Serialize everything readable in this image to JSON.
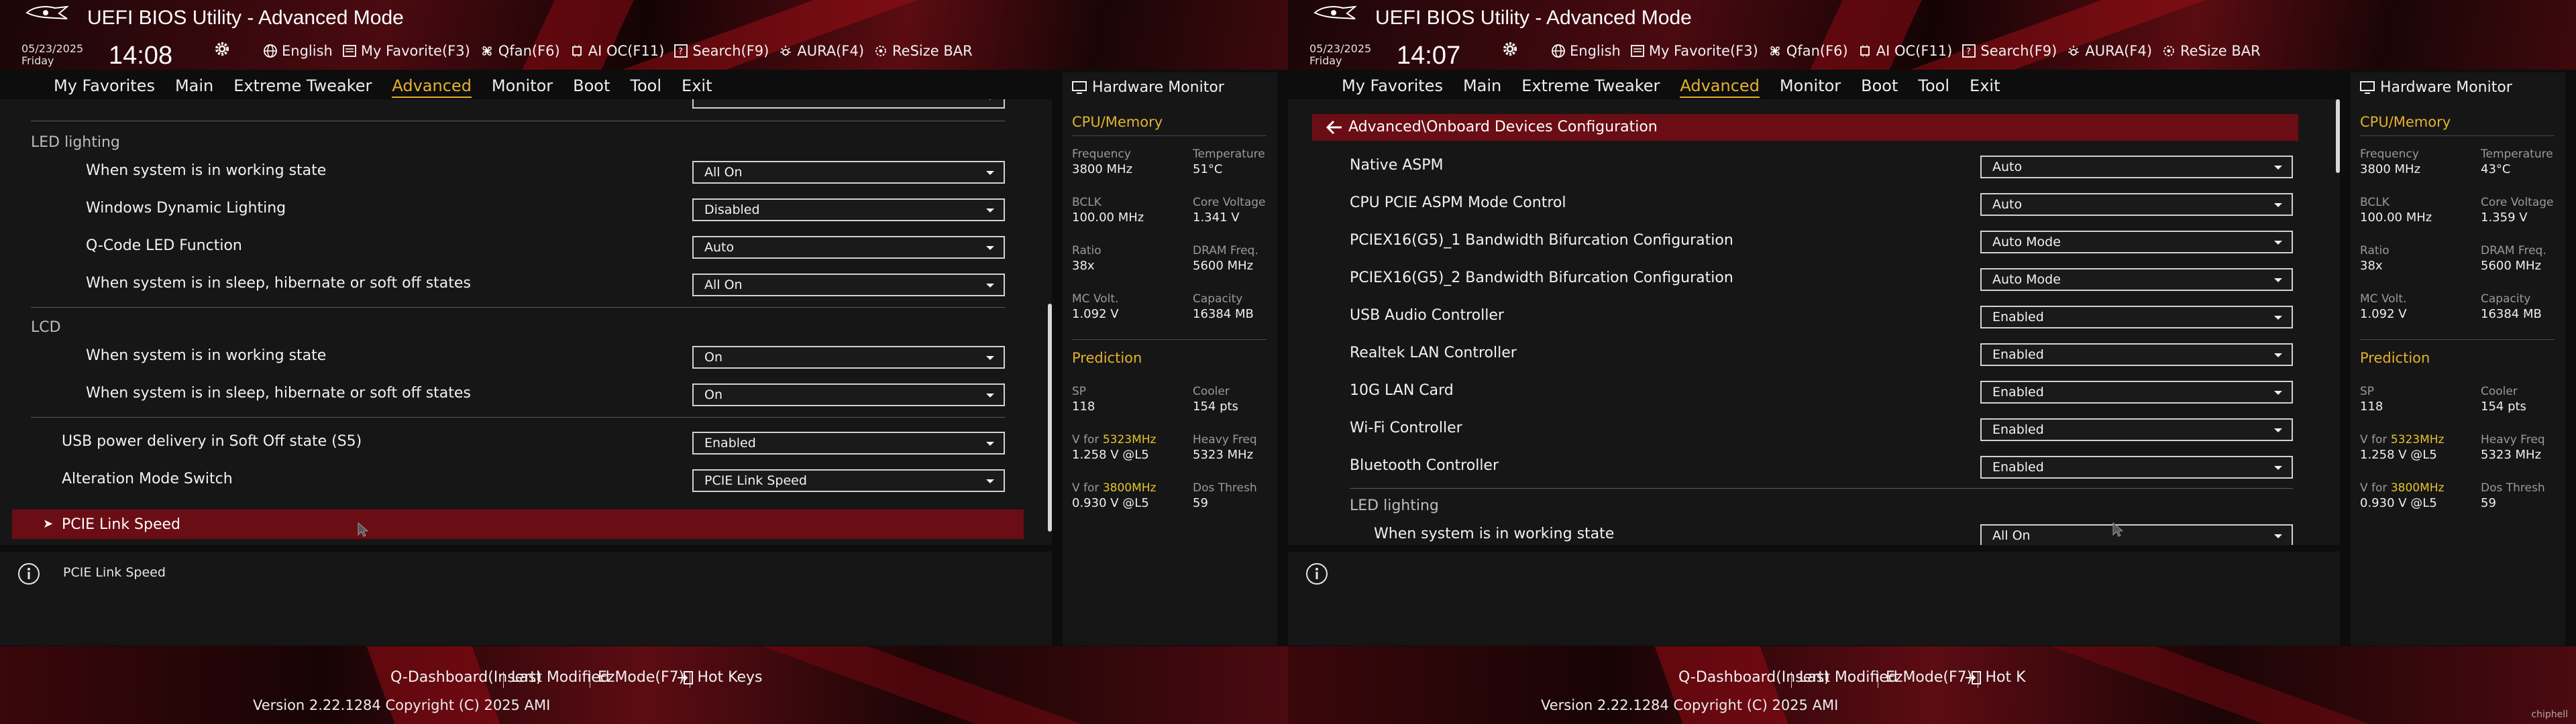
{
  "app_title": "UEFI BIOS Utility - Advanced Mode",
  "colors": {
    "accent": "#e4b22c",
    "highlight": "#6b0d14",
    "brand_red": "#c0101c"
  },
  "screens": [
    {
      "date": "05/23/2025",
      "day": "Friday",
      "time": "14:08",
      "toolbar": [
        "English",
        "My Favorite(F3)",
        "Qfan(F6)",
        "AI OC(F11)",
        "Search(F9)",
        "AURA(F4)",
        "ReSize BAR"
      ],
      "nav": [
        "My Favorites",
        "Main",
        "Extreme Tweaker",
        "Advanced",
        "Monitor",
        "Boot",
        "Tool",
        "Exit"
      ],
      "active_nav": "Advanced",
      "led_group": "LED lighting",
      "led_rows": [
        {
          "label": "When system is in working state",
          "value": "All On"
        },
        {
          "label": "Windows Dynamic Lighting",
          "value": "Disabled"
        },
        {
          "label": "Q-Code LED Function",
          "value": "Auto"
        },
        {
          "label": "When system is in sleep, hibernate or soft off states",
          "value": "All On"
        }
      ],
      "lcd_group": "LCD",
      "lcd_rows": [
        {
          "label": "When system is in working state",
          "value": "On"
        },
        {
          "label": "When system is in sleep, hibernate or soft off states",
          "value": "On"
        }
      ],
      "other_rows": [
        {
          "label": "USB power delivery in Soft Off state (S5)",
          "value": "Enabled"
        },
        {
          "label": "Alteration Mode Switch",
          "value": "PCIE Link Speed"
        }
      ],
      "selected_item": "PCIE Link Speed",
      "help_text": "PCIE Link Speed",
      "hw": {
        "title": "Hardware Monitor",
        "cpu_section": "CPU/Memory",
        "frequency_k": "Frequency",
        "frequency_v": "3800 MHz",
        "temperature_k": "Temperature",
        "temperature_v": "51°C",
        "bclk_k": "BCLK",
        "bclk_v": "100.00 MHz",
        "core_voltage_k": "Core Voltage",
        "core_voltage_v": "1.341 V",
        "ratio_k": "Ratio",
        "ratio_v": "38x",
        "dram_k": "DRAM Freq.",
        "dram_v": "5600 MHz",
        "mcvolt_k": "MC Volt.",
        "mcvolt_v": "1.092 V",
        "capacity_k": "Capacity",
        "capacity_v": "16384 MB",
        "pred_section": "Prediction",
        "sp_k": "SP",
        "sp_v": "118",
        "cooler_k": "Cooler",
        "cooler_v": "154 pts",
        "vfor1_k_pre": "V for ",
        "vfor1_k_hi": "5323MHz",
        "vfor1_v": "1.258 V @L5",
        "heavy_k": "Heavy Freq",
        "heavy_v": "5323 MHz",
        "vfor2_k_pre": "V for ",
        "vfor2_k_hi": "3800MHz",
        "vfor2_v": "0.930 V @L5",
        "dos_k": "Dos Thresh",
        "dos_v": "59"
      },
      "footer": [
        "Q-Dashboard(Insert)",
        "Last Modified",
        "EzMode(F7)",
        "Hot Keys"
      ],
      "copyright": "Version 2.22.1284 Copyright (C) 2025 AMI"
    },
    {
      "date": "05/23/2025",
      "day": "Friday",
      "time": "14:07",
      "toolbar": [
        "English",
        "My Favorite(F3)",
        "Qfan(F6)",
        "AI OC(F11)",
        "Search(F9)",
        "AURA(F4)",
        "ReSize BAR"
      ],
      "nav": [
        "My Favorites",
        "Main",
        "Extreme Tweaker",
        "Advanced",
        "Monitor",
        "Boot",
        "Tool",
        "Exit"
      ],
      "active_nav": "Advanced",
      "breadcrumb": "Advanced\\Onboard Devices Configuration",
      "rows": [
        {
          "label": "Native ASPM",
          "value": "Auto"
        },
        {
          "label": "CPU PCIE ASPM Mode Control",
          "value": "Auto"
        },
        {
          "label": "PCIEX16(G5)_1 Bandwidth Bifurcation Configuration",
          "value": "Auto Mode"
        },
        {
          "label": "PCIEX16(G5)_2 Bandwidth Bifurcation Configuration",
          "value": "Auto Mode"
        },
        {
          "label": "USB Audio Controller",
          "value": "Enabled"
        },
        {
          "label": "Realtek LAN Controller",
          "value": "Enabled"
        },
        {
          "label": "10G LAN Card",
          "value": "Enabled"
        },
        {
          "label": "Wi-Fi Controller",
          "value": "Enabled"
        },
        {
          "label": "Bluetooth Controller",
          "value": "Enabled"
        }
      ],
      "led_group": "LED lighting",
      "led_row": {
        "label": "When system is in working state",
        "value": "All On"
      },
      "hw": {
        "title": "Hardware Monitor",
        "cpu_section": "CPU/Memory",
        "frequency_k": "Frequency",
        "frequency_v": "3800 MHz",
        "temperature_k": "Temperature",
        "temperature_v": "43°C",
        "bclk_k": "BCLK",
        "bclk_v": "100.00 MHz",
        "core_voltage_k": "Core Voltage",
        "core_voltage_v": "1.359 V",
        "ratio_k": "Ratio",
        "ratio_v": "38x",
        "dram_k": "DRAM Freq.",
        "dram_v": "5600 MHz",
        "mcvolt_k": "MC Volt.",
        "mcvolt_v": "1.092 V",
        "capacity_k": "Capacity",
        "capacity_v": "16384 MB",
        "pred_section": "Prediction",
        "sp_k": "SP",
        "sp_v": "118",
        "cooler_k": "Cooler",
        "cooler_v": "154 pts",
        "vfor1_k_pre": "V for ",
        "vfor1_k_hi": "5323MHz",
        "vfor1_v": "1.258 V @L5",
        "heavy_k": "Heavy Freq",
        "heavy_v": "5323 MHz",
        "vfor2_k_pre": "V for ",
        "vfor2_k_hi": "3800MHz",
        "vfor2_v": "0.930 V @L5",
        "dos_k": "Dos Thresh",
        "dos_v": "59"
      },
      "footer": [
        "Q-Dashboard(Insert)",
        "Last Modified",
        "EzMode(F7)",
        "Hot K"
      ],
      "copyright": "Version 2.22.1284 Copyright (C) 2025 AMI",
      "watermark": "chiphell"
    }
  ]
}
